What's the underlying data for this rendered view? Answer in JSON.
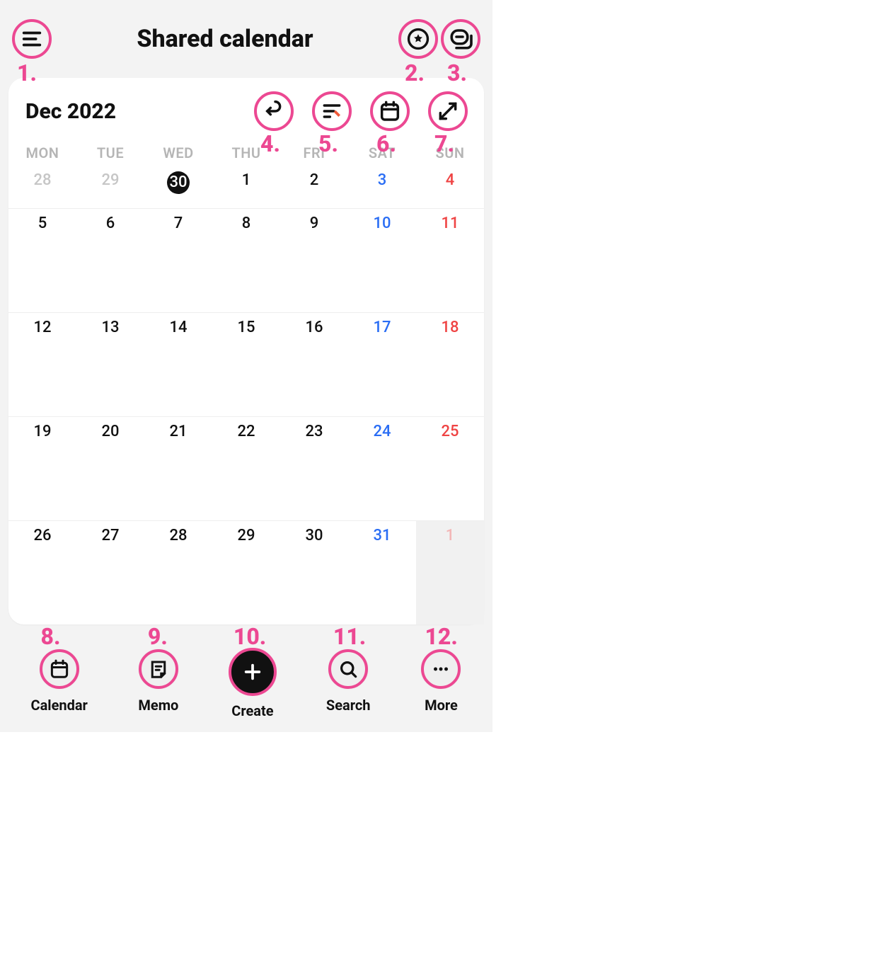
{
  "header": {
    "title": "Shared calendar"
  },
  "annotations": [
    "1.",
    "2.",
    "3.",
    "4.",
    "5.",
    "6.",
    "7.",
    "8.",
    "9.",
    "10.",
    "11.",
    "12."
  ],
  "calendar": {
    "month_label": "Dec 2022",
    "dow": [
      "MON",
      "TUE",
      "WED",
      "THU",
      "FRI",
      "SAT",
      "SUN"
    ],
    "days": [
      {
        "n": "28",
        "cls": "prev"
      },
      {
        "n": "29",
        "cls": "prev"
      },
      {
        "n": "30",
        "cls": "today"
      },
      {
        "n": "1",
        "cls": ""
      },
      {
        "n": "2",
        "cls": ""
      },
      {
        "n": "3",
        "cls": "sat"
      },
      {
        "n": "4",
        "cls": "sun"
      },
      {
        "n": "5",
        "cls": ""
      },
      {
        "n": "6",
        "cls": ""
      },
      {
        "n": "7",
        "cls": ""
      },
      {
        "n": "8",
        "cls": ""
      },
      {
        "n": "9",
        "cls": ""
      },
      {
        "n": "10",
        "cls": "sat"
      },
      {
        "n": "11",
        "cls": "sun"
      },
      {
        "n": "12",
        "cls": ""
      },
      {
        "n": "13",
        "cls": ""
      },
      {
        "n": "14",
        "cls": ""
      },
      {
        "n": "15",
        "cls": ""
      },
      {
        "n": "16",
        "cls": ""
      },
      {
        "n": "17",
        "cls": "sat"
      },
      {
        "n": "18",
        "cls": "sun"
      },
      {
        "n": "19",
        "cls": ""
      },
      {
        "n": "20",
        "cls": ""
      },
      {
        "n": "21",
        "cls": ""
      },
      {
        "n": "22",
        "cls": ""
      },
      {
        "n": "23",
        "cls": ""
      },
      {
        "n": "24",
        "cls": "sat"
      },
      {
        "n": "25",
        "cls": "sun"
      },
      {
        "n": "26",
        "cls": ""
      },
      {
        "n": "27",
        "cls": ""
      },
      {
        "n": "28",
        "cls": ""
      },
      {
        "n": "29",
        "cls": ""
      },
      {
        "n": "30",
        "cls": ""
      },
      {
        "n": "31",
        "cls": "sat"
      },
      {
        "n": "1",
        "cls": "next sun bgnext"
      }
    ]
  },
  "tabs": {
    "calendar": "Calendar",
    "memo": "Memo",
    "create": "Create",
    "search": "Search",
    "more": "More"
  }
}
